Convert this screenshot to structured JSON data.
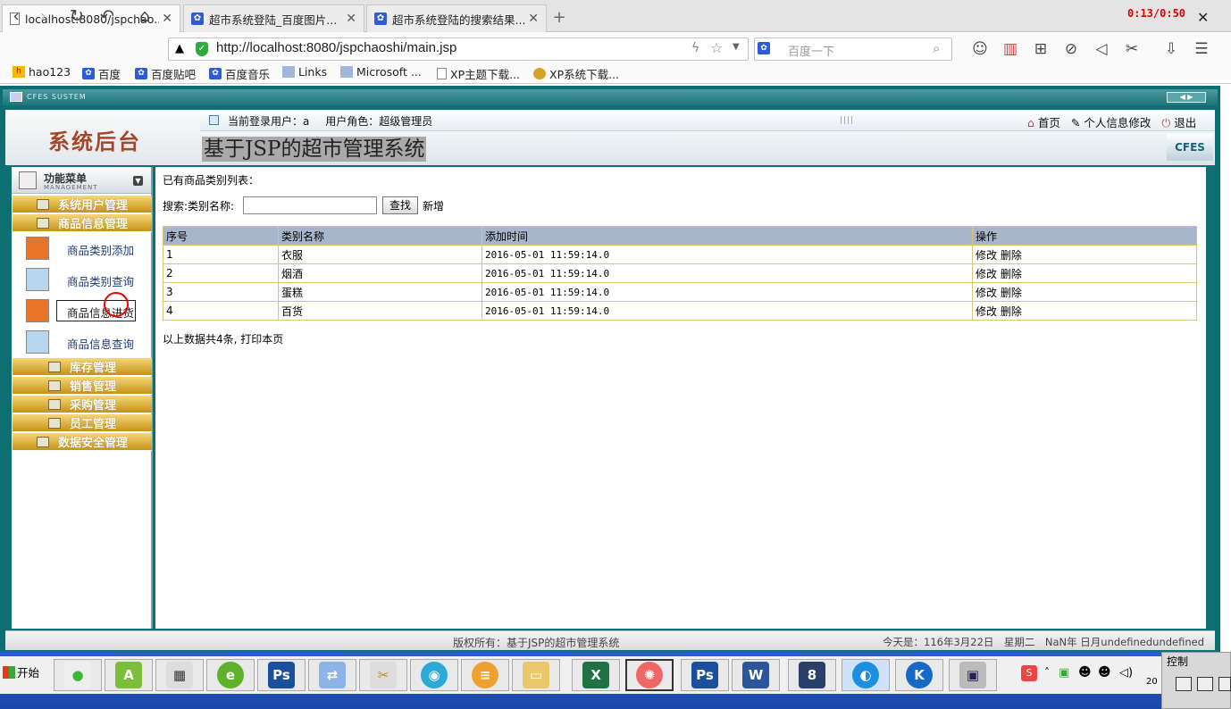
{
  "browser": {
    "tabs": [
      {
        "title": "localhost:8080/jspchao...",
        "icon": "page-icon"
      },
      {
        "title": "超市系统登陆_百度图片...",
        "icon": "baidu-paw-icon"
      },
      {
        "title": "超市系统登陆的搜索结果...",
        "icon": "baidu-paw-icon"
      }
    ],
    "timer": "0:13/0:50",
    "url": "http://localhost:8080/jspchaoshi/main.jsp",
    "search_placeholder": "百度一下",
    "bookmarks": [
      {
        "label": "hao123",
        "icon": "hao"
      },
      {
        "label": "百度",
        "icon": "baidu"
      },
      {
        "label": "百度贴吧",
        "icon": "baidu"
      },
      {
        "label": "百度音乐",
        "icon": "baidu"
      },
      {
        "label": "Links",
        "icon": "folder"
      },
      {
        "label": "Microsoft ...",
        "icon": "folder"
      },
      {
        "label": "XP主题下载...",
        "icon": "doc"
      },
      {
        "label": "XP系统下载...",
        "icon": "xp"
      }
    ]
  },
  "app": {
    "window_title": "CFES SUSTEM",
    "logo_title": "系统后台",
    "system_name": "基于JSP的超市管理系统",
    "current_user": "当前登录用户：a",
    "user_role": "用户角色：超级管理员",
    "links": {
      "home": "首页",
      "profile": "个人信息修改",
      "logout": "退出"
    },
    "brand": "CFES",
    "menu": {
      "header": "功能菜单",
      "header_sub": "MANAGEMENT",
      "categories_top": [
        "系统用户管理",
        "商品信息管理"
      ],
      "subitems": [
        "商品类别添加",
        "商品类别查询",
        "商品信息进货",
        "商品信息查询"
      ],
      "categories_bottom": [
        "库存管理",
        "销售管理",
        "采购管理",
        "员工管理",
        "数据安全管理"
      ]
    },
    "main": {
      "list_title": "已有商品类别列表：",
      "search_label": "搜索:类别名称:",
      "search_value": "",
      "find_button": "查找",
      "add_link": "新增",
      "columns": [
        "序号",
        "类别名称",
        "添加时间",
        "操作"
      ],
      "rows": [
        {
          "no": "1",
          "name": "衣服",
          "time": "2016-05-01 11:59:14.0"
        },
        {
          "no": "2",
          "name": "烟酒",
          "time": "2016-05-01 11:59:14.0"
        },
        {
          "no": "3",
          "name": "蛋糕",
          "time": "2016-05-01 11:59:14.0"
        },
        {
          "no": "4",
          "name": "百货",
          "time": "2016-05-01 11:59:14.0"
        }
      ],
      "edit_label": "修改",
      "delete_label": "删除",
      "footer_note": "以上数据共4条, 打印本页"
    },
    "copyright": "版权所有：基于JSP的超市管理系统",
    "today": "今天是：116年3月22日　星期二　NaN年 日月undefinedundefined"
  },
  "taskbar": {
    "start": "开始",
    "control_panel": "控制",
    "clock_partial": "20"
  }
}
